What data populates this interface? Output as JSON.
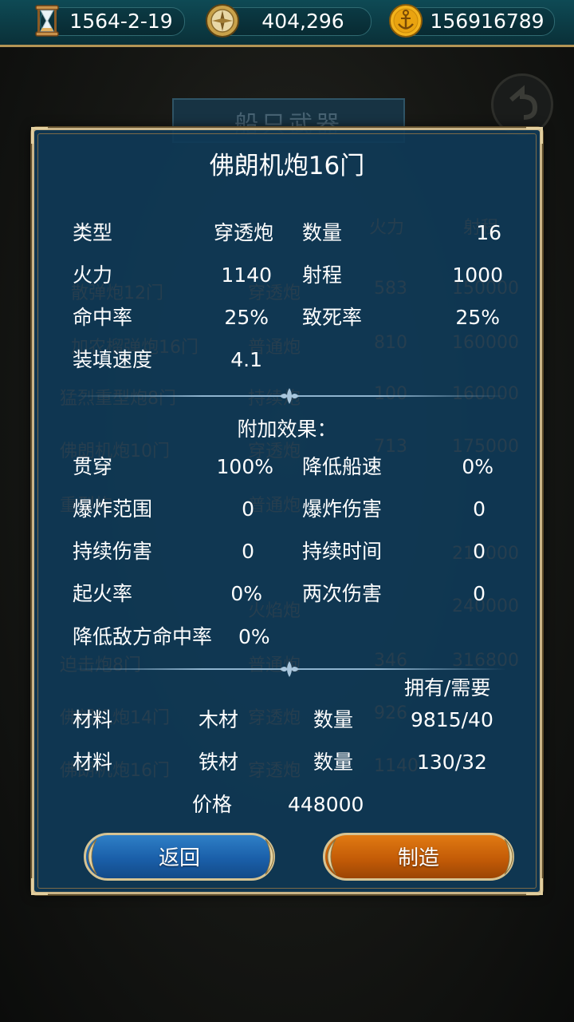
{
  "topbar": {
    "date": "1564-2-19",
    "silver": "404,296",
    "gold": "156916789",
    "icons": [
      "hourglass-icon",
      "compass-coin-icon",
      "anchor-coin-icon"
    ]
  },
  "dialog": {
    "title": "佛朗机炮16门",
    "stats": [
      {
        "label": "类型",
        "value": "穿透炮"
      },
      {
        "label": "数量",
        "value": "16"
      },
      {
        "label": "火力",
        "value": "1140"
      },
      {
        "label": "射程",
        "value": "1000"
      },
      {
        "label": "命中率",
        "value": "25%"
      },
      {
        "label": "致死率",
        "value": "25%"
      },
      {
        "label": "装填速度",
        "value": "4.1"
      }
    ],
    "extra_title": "附加效果：",
    "extras": [
      {
        "label": "贯穿",
        "value": "100%"
      },
      {
        "label": "降低船速",
        "value": "0%"
      },
      {
        "label": "爆炸范围",
        "value": "0"
      },
      {
        "label": "爆炸伤害",
        "value": "0"
      },
      {
        "label": "持续伤害",
        "value": "0"
      },
      {
        "label": "持续时间",
        "value": "0"
      },
      {
        "label": "起火率",
        "value": "0%"
      },
      {
        "label": "两次伤害",
        "value": "0"
      },
      {
        "label": "降低敌方命中率",
        "value": "0%"
      }
    ],
    "materials_header": "拥有/需要",
    "materials": [
      {
        "label": "材料",
        "name": "木材",
        "qty_label": "数量",
        "qty": "9815/40"
      },
      {
        "label": "材料",
        "name": "铁材",
        "qty_label": "数量",
        "qty": "130/32"
      }
    ],
    "price_label": "价格",
    "price": "448000",
    "back_button": "返回",
    "craft_button": "制造"
  },
  "background": {
    "banner": "船只武器",
    "ghost_rows": [
      "火力",
      "射程",
      "散弹炮12门",
      "穿透炮",
      "583",
      "150000",
      "加农榴弹炮16门",
      "普通炮",
      "810",
      "160000",
      "猛烈重型炮8门",
      "持续炮",
      "100",
      "160000",
      "佛朗机炮10门",
      "穿透炮",
      "713",
      "175000",
      "重型炮",
      "普通炮",
      "210000",
      "火焰炮",
      "240000",
      "迫击炮8门",
      "普通炮",
      "346",
      "316800",
      "佛朗机炮14门",
      "穿透炮",
      "926",
      "佛朗机炮16门",
      "穿透炮",
      "1140"
    ]
  }
}
